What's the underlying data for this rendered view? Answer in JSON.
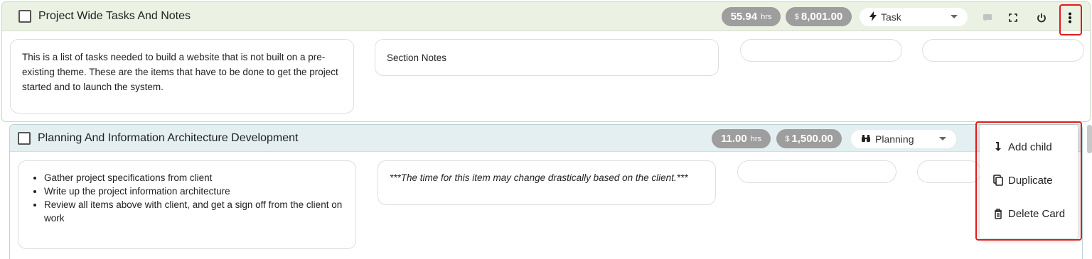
{
  "card1": {
    "title": "Project Wide Tasks And Notes",
    "hours": "55.94",
    "hours_unit": "hrs",
    "currency": "$",
    "amount": "8,001.00",
    "type_icon": "bolt-icon",
    "type_label": "Task",
    "description": "This is a list of tasks needed to build a website that is not built on a pre-existing theme. These are the items that have to be done to get the project started and to launch the system.",
    "notes": "Section Notes"
  },
  "card2": {
    "title": "Planning And Information Architecture Development",
    "hours": "11.00",
    "hours_unit": "hrs",
    "currency": "$",
    "amount": "1,500.00",
    "type_icon": "binoculars-icon",
    "type_label": "Planning",
    "bullets": [
      "Gather project specifications from client",
      "Write up the project information architecture",
      "Review all items above with client, and get a sign off from the client on work"
    ],
    "notes": "***The time for this item may change drastically based on the client.***"
  },
  "menu": {
    "items": [
      {
        "label": "Add child",
        "icon": "arrow-down-icon"
      },
      {
        "label": "Duplicate",
        "icon": "copy-icon"
      },
      {
        "label": "Delete Card",
        "icon": "trash-icon"
      }
    ]
  },
  "colors": {
    "card1_header": "#ebf1e3",
    "card2_header": "#e4eff1",
    "pill": "#9e9e9e",
    "highlight": "#e01b1b"
  }
}
